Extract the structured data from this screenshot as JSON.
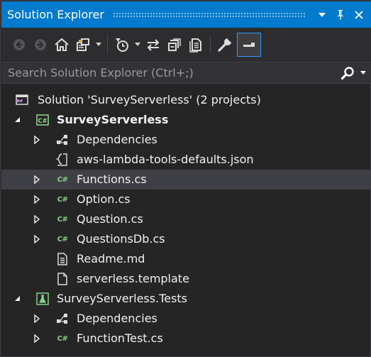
{
  "window": {
    "title": "Solution Explorer",
    "controls": {
      "dropdown": "▾",
      "pin": "⊥",
      "close": "✕"
    }
  },
  "toolbar": {
    "buttons": [
      "back-icon",
      "forward-icon",
      "home-icon",
      "switch-views-icon",
      "pending-changes-filter-icon",
      "sync-with-active-document-icon",
      "collapse-all-icon",
      "show-all-files-icon",
      "properties-icon",
      "preview-selected-items-icon"
    ]
  },
  "search": {
    "placeholder": "Search Solution Explorer (Ctrl+;)",
    "value": ""
  },
  "tree": {
    "solution_label": "Solution 'SurveyServerless' (2 projects)",
    "project1": {
      "name": "SurveyServerless",
      "items": [
        "Dependencies",
        "aws-lambda-tools-defaults.json",
        "Functions.cs",
        "Option.cs",
        "Question.cs",
        "QuestionsDb.cs",
        "Readme.md",
        "serverless.template"
      ]
    },
    "project2": {
      "name": "SurveyServerless.Tests",
      "items": [
        "Dependencies",
        "FunctionTest.cs"
      ]
    },
    "selected_item": "Functions.cs"
  },
  "colors": {
    "titlebar": "#007acc",
    "background": "#252526",
    "selection": "#3f3f46",
    "csharp_green": "#89d185",
    "toolbar_active_border": "#3399ff"
  }
}
